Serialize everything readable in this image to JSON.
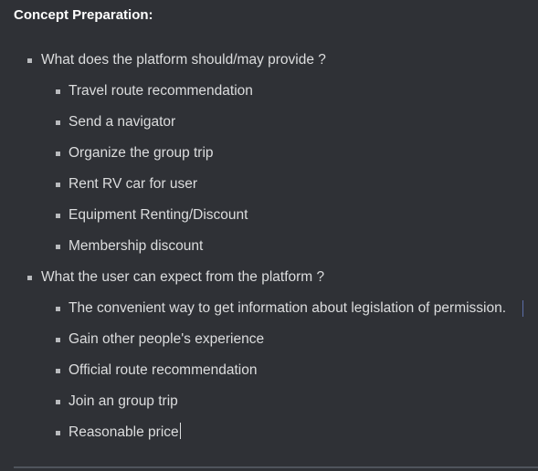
{
  "title": "Concept Preparation:",
  "sections": [
    {
      "label": "What does the platform should/may provide ?",
      "items": [
        "Travel route recommendation",
        "Send a navigator",
        "Organize the group trip",
        "Rent RV car for user",
        "Equipment Renting/Discount",
        "Membership discount"
      ]
    },
    {
      "label": "What the user can expect from the platform ?",
      "items": [
        "The convenient way to get information about legislation of permission.",
        "Gain other people's experience",
        "Official route recommendation",
        "Join an group trip",
        "Reasonable price"
      ]
    }
  ],
  "colors": {
    "background": "#2f3136",
    "text": "#dcddde",
    "title": "#ffffff"
  }
}
